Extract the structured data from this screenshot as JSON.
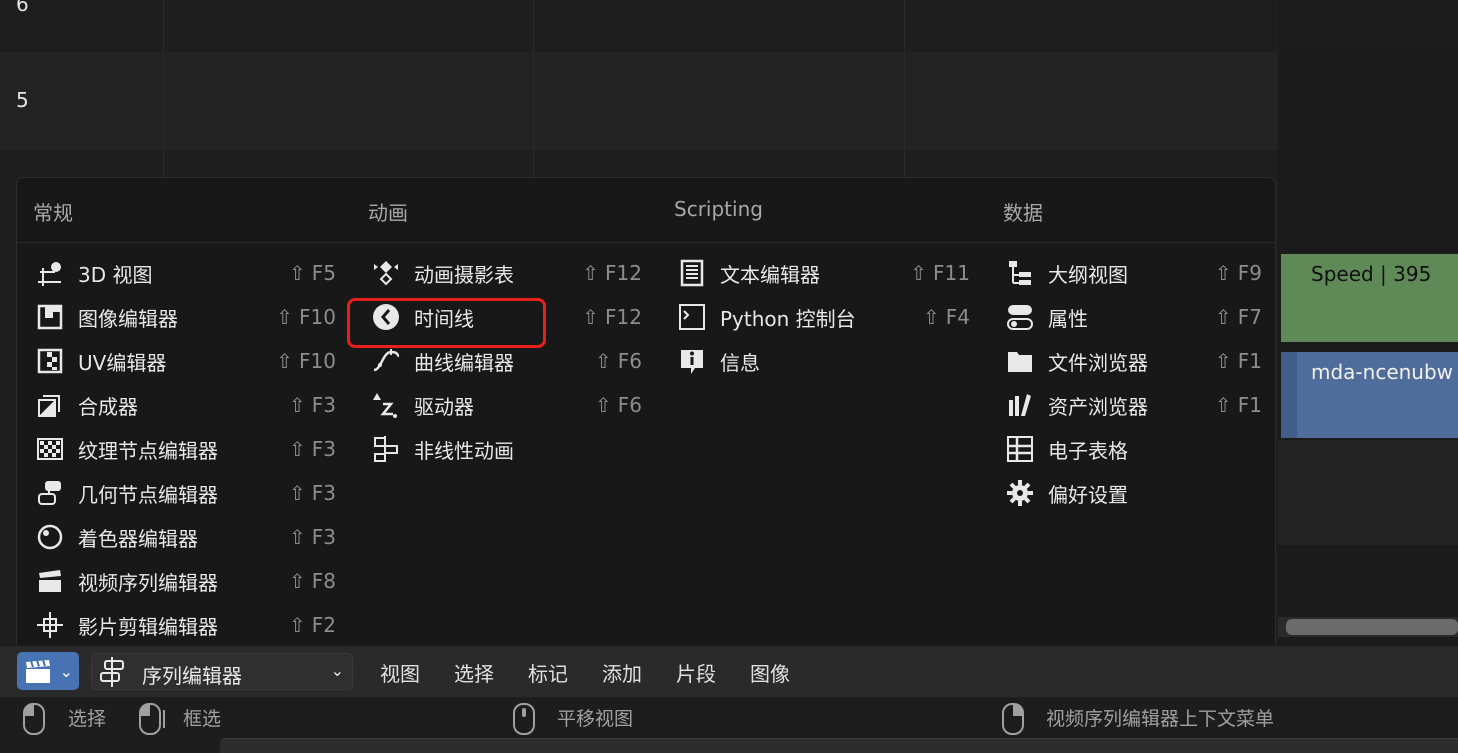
{
  "background": {
    "channel_numbers": [
      "6",
      "5"
    ],
    "strips": {
      "speed": "Speed | 395",
      "movie": "mda-ncenubw"
    }
  },
  "popup": {
    "columns": [
      {
        "title": "常规",
        "items": [
          {
            "label": "3D 视图",
            "shortcut": "F5",
            "icon": "3d-view-icon"
          },
          {
            "label": "图像编辑器",
            "shortcut": "F10",
            "icon": "image-editor-icon"
          },
          {
            "label": "UV编辑器",
            "shortcut": "F10",
            "icon": "uv-editor-icon"
          },
          {
            "label": "合成器",
            "shortcut": "F3",
            "icon": "compositor-icon"
          },
          {
            "label": "纹理节点编辑器",
            "shortcut": "F3",
            "icon": "texture-node-icon"
          },
          {
            "label": "几何节点编辑器",
            "shortcut": "F3",
            "icon": "geometry-node-icon"
          },
          {
            "label": "着色器编辑器",
            "shortcut": "F3",
            "icon": "shader-editor-icon"
          },
          {
            "label": "视频序列编辑器",
            "shortcut": "F8",
            "icon": "sequencer-icon"
          },
          {
            "label": "影片剪辑编辑器",
            "shortcut": "F2",
            "icon": "clip-editor-icon"
          }
        ]
      },
      {
        "title": "动画",
        "items": [
          {
            "label": "动画摄影表",
            "shortcut": "F12",
            "icon": "dopesheet-icon"
          },
          {
            "label": "时间线",
            "shortcut": "F12",
            "icon": "timeline-icon"
          },
          {
            "label": "曲线编辑器",
            "shortcut": "F6",
            "icon": "graph-editor-icon"
          },
          {
            "label": "驱动器",
            "shortcut": "F6",
            "icon": "drivers-icon"
          },
          {
            "label": "非线性动画",
            "shortcut": "",
            "icon": "nla-icon"
          }
        ]
      },
      {
        "title": "Scripting",
        "items": [
          {
            "label": "文本编辑器",
            "shortcut": "F11",
            "icon": "text-editor-icon"
          },
          {
            "label": "Python 控制台",
            "shortcut": "F4",
            "icon": "python-console-icon"
          },
          {
            "label": "信息",
            "shortcut": "",
            "icon": "info-icon"
          }
        ]
      },
      {
        "title": "数据",
        "items": [
          {
            "label": "大纲视图",
            "shortcut": "F9",
            "icon": "outliner-icon"
          },
          {
            "label": "属性",
            "shortcut": "F7",
            "icon": "properties-icon"
          },
          {
            "label": "文件浏览器",
            "shortcut": "F1",
            "icon": "file-browser-icon"
          },
          {
            "label": "资产浏览器",
            "shortcut": "F1",
            "icon": "asset-browser-icon"
          },
          {
            "label": "电子表格",
            "shortcut": "",
            "icon": "spreadsheet-icon"
          },
          {
            "label": "偏好设置",
            "shortcut": "",
            "icon": "preferences-icon"
          }
        ]
      }
    ],
    "shift_symbol": "⇧"
  },
  "header": {
    "editor_type_icon": "sequencer-icon",
    "view_type_label": "序列编辑器",
    "menus": [
      "视图",
      "选择",
      "标记",
      "添加",
      "片段",
      "图像"
    ]
  },
  "status": {
    "left_select": "选择",
    "box_select": "框选",
    "pan_view": "平移视图",
    "context_menu": "视频序列编辑器上下文菜单"
  },
  "colors": {
    "accent": "#4772b3",
    "highlight_red": "#e8201c",
    "speed_strip": "#5f8a57",
    "movie_strip": "#4f6c9a"
  }
}
